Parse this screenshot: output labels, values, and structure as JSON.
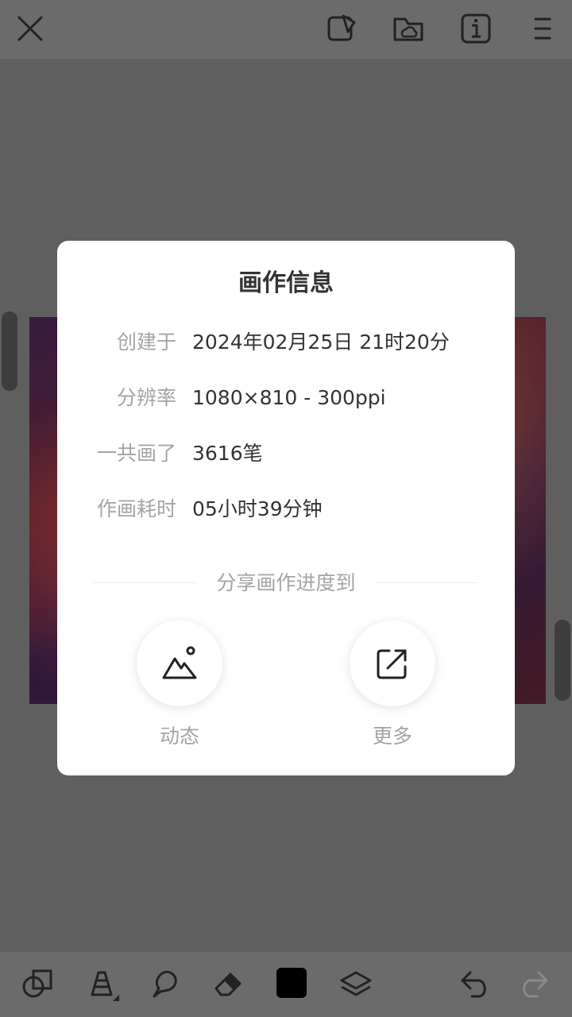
{
  "toolbar_top": {
    "close_icon": "close-icon",
    "icons": [
      "canvas-edit-icon",
      "cloud-folder-icon",
      "info-icon",
      "menu-icon"
    ]
  },
  "dialog": {
    "title": "画作信息",
    "rows": [
      {
        "label": "创建于",
        "value": "2024年02月25日 21时20分"
      },
      {
        "label": "分辨率",
        "value": "1080×810 - 300ppi"
      },
      {
        "label": "一共画了",
        "value": "3616笔"
      },
      {
        "label": "作画耗时",
        "value": "05小时39分钟"
      }
    ],
    "share_heading": "分享画作进度到",
    "share_options": [
      {
        "label": "动态",
        "icon": "image-mountain-icon"
      },
      {
        "label": "更多",
        "icon": "external-share-icon"
      }
    ]
  },
  "toolbar_bottom": {
    "icons": [
      "shapes-icon",
      "pen-icon",
      "smudge-icon",
      "eraser-icon",
      "color-swatch-icon",
      "layers-icon",
      "undo-icon",
      "redo-icon"
    ],
    "current_color": "#000000"
  },
  "colors": {
    "overlay_bg": "#5f5f5f",
    "dialog_bg": "#ffffff",
    "label_gray": "#a4a4a4",
    "value_dark": "#333333"
  }
}
